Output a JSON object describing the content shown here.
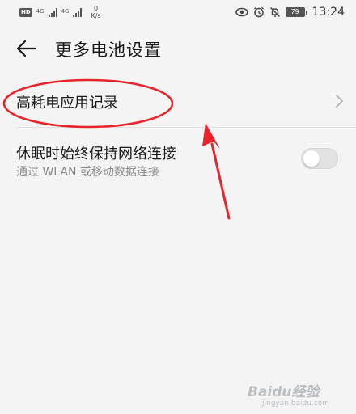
{
  "status_bar": {
    "hd_label": "HD",
    "net_type_1": "4G",
    "net_type_2": "4G",
    "speed_value": "0",
    "speed_unit": "K/s",
    "battery_level": "79",
    "time": "13:24",
    "icons": [
      "hd-icon",
      "signal-icon",
      "eye-icon",
      "alarm-icon",
      "mute-icon",
      "battery-icon"
    ]
  },
  "header": {
    "title": "更多电池设置",
    "back_icon": "arrow-left-icon"
  },
  "list": {
    "item1": {
      "label": "高耗电应用记录",
      "chevron_icon": "chevron-right-icon"
    },
    "item2": {
      "title": "休眠时始终保持网络连接",
      "subtitle": "通过 WLAN 或移动数据连接",
      "toggle_on": false
    }
  },
  "annotation": {
    "color": "#e8232a"
  },
  "watermark": {
    "brand": "Baidu经验",
    "url": "jingyan.baidu.com"
  },
  "colors": {
    "background": "#f4f4f4",
    "text_primary": "#1a1a1a",
    "text_secondary": "#8a8a8a",
    "toggle_off": "#e2e2e2"
  }
}
